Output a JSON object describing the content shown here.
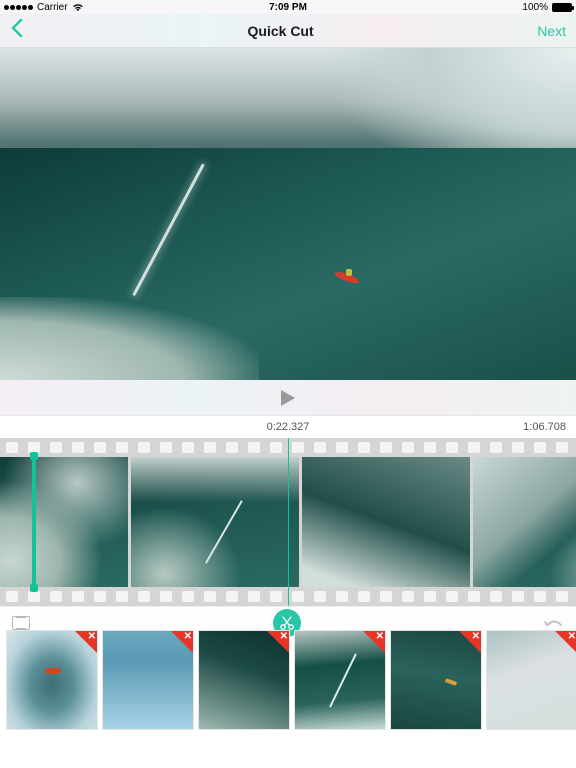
{
  "status": {
    "carrier": "Carrier",
    "time": "7:09 PM",
    "battery": "100%"
  },
  "nav": {
    "title": "Quick Cut",
    "next": "Next"
  },
  "timebar": {
    "current": "0:22.327",
    "end": "1:06.708"
  },
  "playIcon": "play-icon",
  "tools": {
    "frame": "frame-icon",
    "cut": "scissors-icon",
    "undo": "undo-icon"
  },
  "filmFrames": [
    {
      "id": "frame-0"
    },
    {
      "id": "frame-1"
    },
    {
      "id": "frame-2"
    },
    {
      "id": "frame-3"
    }
  ],
  "clips": [
    {
      "delete": true
    },
    {
      "delete": true
    },
    {
      "delete": true
    },
    {
      "delete": true
    },
    {
      "delete": true
    },
    {
      "delete": true
    }
  ]
}
